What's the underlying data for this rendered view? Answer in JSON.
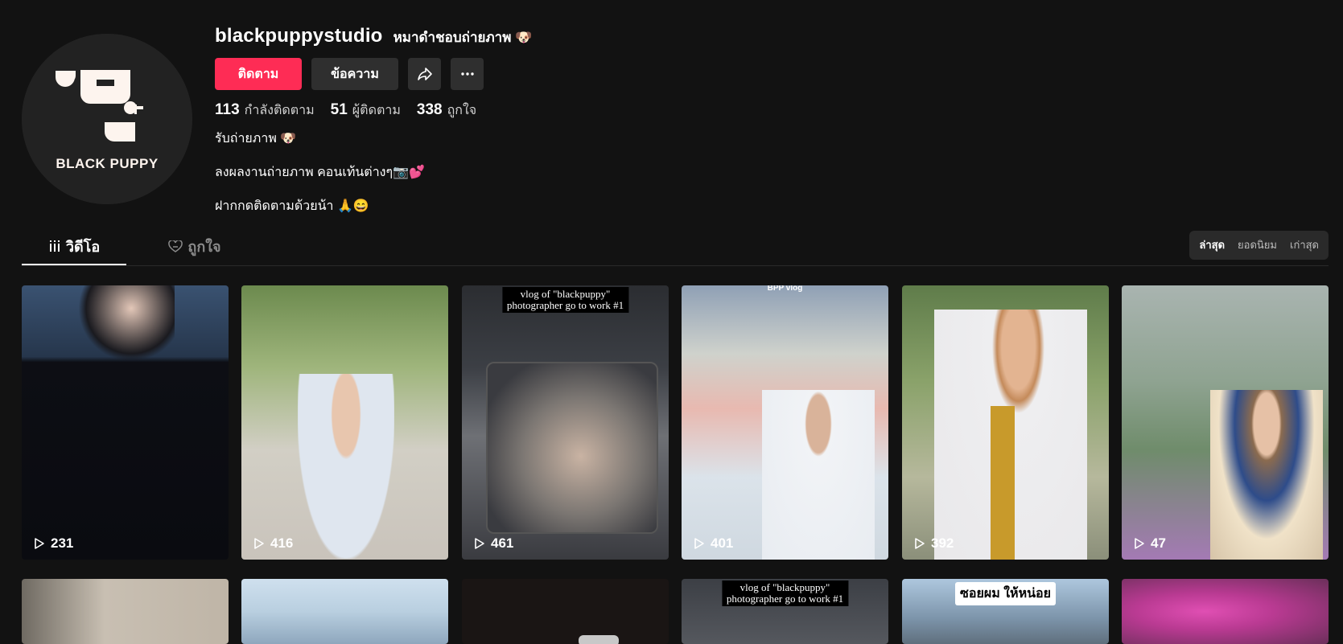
{
  "profile": {
    "username": "blackpuppystudio",
    "nickname": "หมาดำชอบถ่ายภาพ 🐶",
    "avatar_text": "BLACK PUPPY",
    "follow_label": "ติดตาม",
    "message_label": "ข้อความ",
    "share_icon": "share-icon",
    "more_icon": "more-icon",
    "stats": [
      {
        "value": "113",
        "label": "กำลังติดตาม"
      },
      {
        "value": "51",
        "label": "ผู้ติดตาม"
      },
      {
        "value": "338",
        "label": "ถูกใจ"
      }
    ],
    "bio": [
      "รับถ่ายภาพ 🐶",
      "ลงผลงานถ่ายภาพ คอนเท้นต่างๆ📷💕",
      "ฝากกดติดตามด้วยน้า 🙏😄"
    ]
  },
  "tabs": {
    "videos": "วิดีโอ",
    "liked": "ถูกใจ"
  },
  "sort": [
    "ล่าสุด",
    "ยอดนิยม",
    "เก่าสุด"
  ],
  "videos_row1": [
    {
      "views": "231"
    },
    {
      "views": "416"
    },
    {
      "views": "461",
      "overlay_line1": "vlog of \"blackpuppy\"",
      "overlay_line2": "photographer go to work #1"
    },
    {
      "views": "401",
      "overlay_top": "BPP vlog"
    },
    {
      "views": "392"
    },
    {
      "views": "47"
    }
  ],
  "videos_row2": [
    {},
    {},
    {},
    {
      "overlay_line1": "vlog of \"blackpuppy\"",
      "overlay_line2": "photographer go to work #1"
    },
    {
      "sticker": "ซอยผม ให้หน่อย"
    },
    {}
  ],
  "colors": {
    "background": "#121212",
    "follow": "#fe2c55",
    "secondary_button": "#2f2f2f"
  }
}
